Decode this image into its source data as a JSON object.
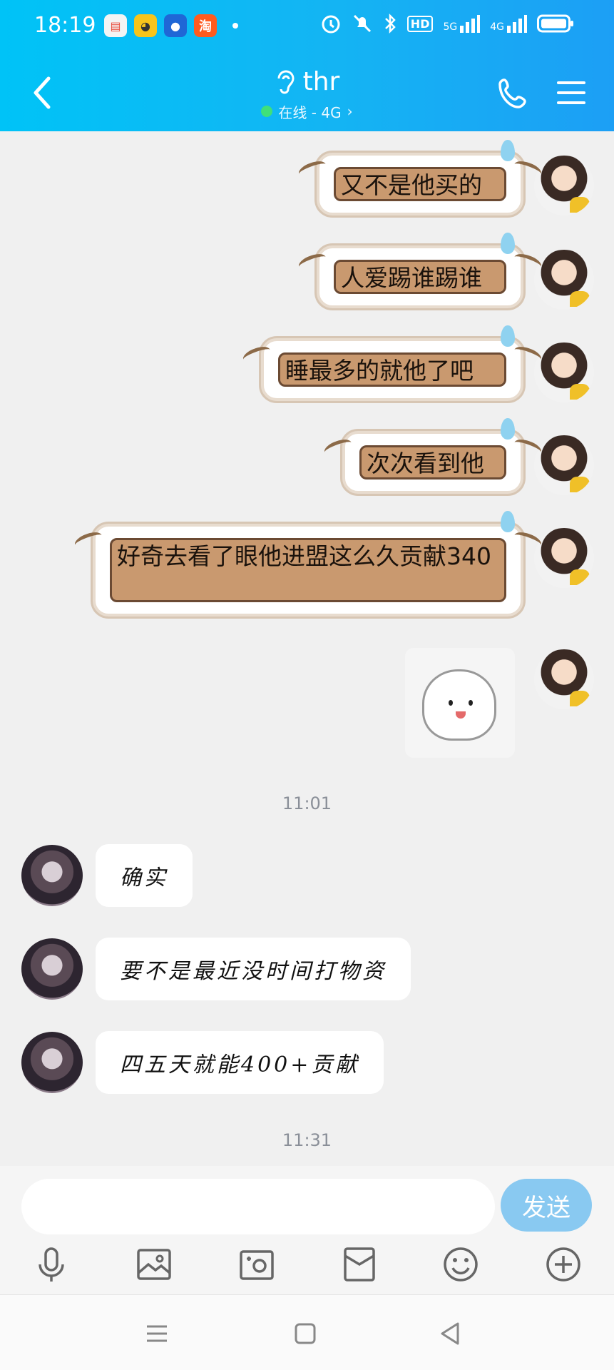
{
  "status_bar": {
    "time": "18:19",
    "app_icons": [
      {
        "name": "wallet-app-icon",
        "glyph": "▤",
        "color": "#f4f4f4"
      },
      {
        "name": "yellow-app-icon",
        "glyph": "◕",
        "color": "#f8c41b"
      },
      {
        "name": "blue-app-icon",
        "glyph": "●",
        "color": "#1f67d6"
      },
      {
        "name": "taobao-app-icon",
        "glyph": "淘",
        "color": "#ff5b1f"
      }
    ],
    "hd_label": "HD",
    "signal_1": "5G",
    "signal_2": "4G"
  },
  "header": {
    "title": "thr",
    "status": "在线 - 4G",
    "status_color": "#3fe07a",
    "back_icon": "chevron-left-icon",
    "call_icon": "phone-icon",
    "menu_icon": "hamburger-menu-icon"
  },
  "messages_sent": [
    {
      "text": "又不是他买的"
    },
    {
      "text": "人爱踢谁踢谁"
    },
    {
      "text": "睡最多的就他了吧"
    },
    {
      "text": "次次看到他"
    },
    {
      "text": "好奇去看了眼他进盟这么久贡献340"
    }
  ],
  "sticker": {
    "type": "bunny-sticker"
  },
  "timestamps": [
    "11:01",
    "11:31"
  ],
  "messages_received": [
    {
      "text": "确实"
    },
    {
      "text": "要不是最近没时间打物资"
    },
    {
      "text": "四五天就能400+贡献"
    }
  ],
  "input": {
    "placeholder": "",
    "send_label": "发送",
    "send_color": "#89c9f1"
  },
  "toolbar_icons": [
    "microphone-icon",
    "image-icon",
    "camera-icon",
    "red-packet-icon",
    "emoji-icon",
    "plus-icon"
  ],
  "system_nav": [
    "menu-nav-icon",
    "home-nav-icon",
    "back-nav-icon"
  ]
}
